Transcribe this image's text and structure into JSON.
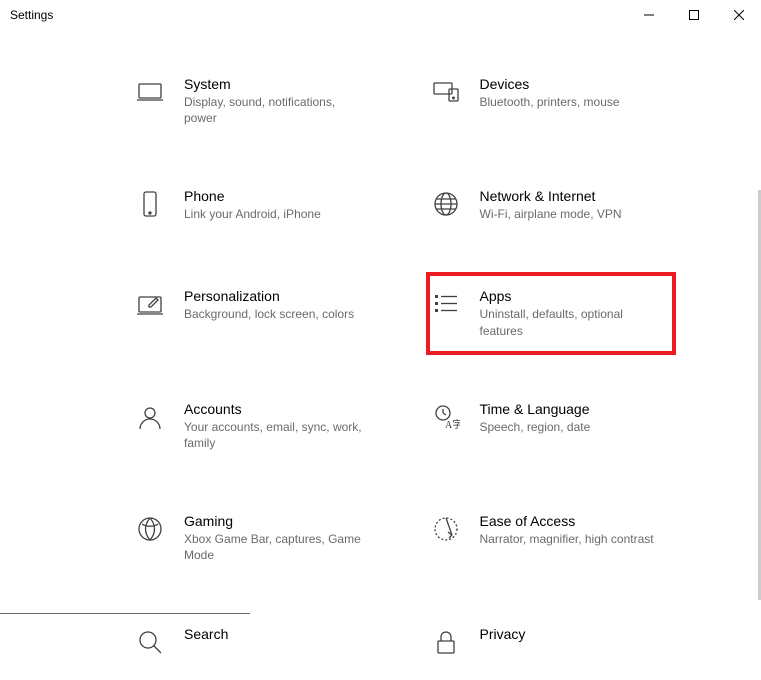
{
  "window": {
    "title": "Settings"
  },
  "categories": [
    {
      "key": "system",
      "title": "System",
      "sub": "Display, sound, notifications, power"
    },
    {
      "key": "devices",
      "title": "Devices",
      "sub": "Bluetooth, printers, mouse"
    },
    {
      "key": "phone",
      "title": "Phone",
      "sub": "Link your Android, iPhone"
    },
    {
      "key": "network",
      "title": "Network & Internet",
      "sub": "Wi-Fi, airplane mode, VPN"
    },
    {
      "key": "personalization",
      "title": "Personalization",
      "sub": "Background, lock screen, colors"
    },
    {
      "key": "apps",
      "title": "Apps",
      "sub": "Uninstall, defaults, optional features",
      "highlight": true
    },
    {
      "key": "accounts",
      "title": "Accounts",
      "sub": "Your accounts, email, sync, work, family"
    },
    {
      "key": "time",
      "title": "Time & Language",
      "sub": "Speech, region, date"
    },
    {
      "key": "gaming",
      "title": "Gaming",
      "sub": "Xbox Game Bar, captures, Game Mode"
    },
    {
      "key": "ease",
      "title": "Ease of Access",
      "sub": "Narrator, magnifier, high contrast"
    },
    {
      "key": "search",
      "title": "Search",
      "sub": ""
    },
    {
      "key": "privacy",
      "title": "Privacy",
      "sub": ""
    }
  ]
}
